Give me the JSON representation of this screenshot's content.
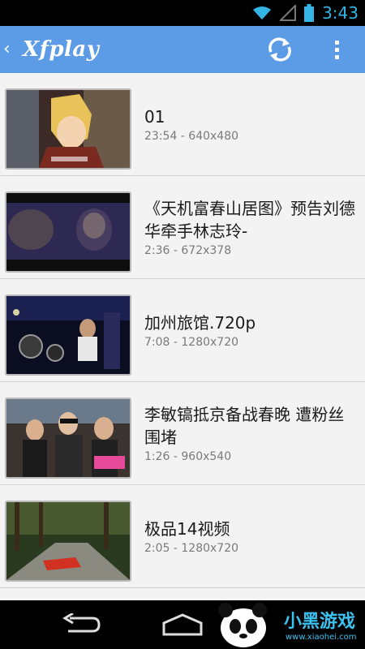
{
  "status_bar": {
    "time": "3:43",
    "icons": [
      "wifi-icon",
      "signal-icon",
      "battery-icon"
    ]
  },
  "action_bar": {
    "back_glyph": "‹",
    "title": "Xfplay",
    "refresh_icon": "refresh-icon",
    "overflow_icon": "overflow-menu-icon"
  },
  "videos": [
    {
      "title": "01",
      "meta": "23:54 - 640x480",
      "thumb_icon": "anime-thumbnail"
    },
    {
      "title": "《天机富春山居图》预告刘德华牵手林志玲-",
      "meta": "2:36 - 672x378",
      "thumb_icon": "movie-trailer-thumbnail"
    },
    {
      "title": "加州旅馆.720p",
      "meta": "7:08 - 1280x720",
      "thumb_icon": "concert-thumbnail"
    },
    {
      "title": "李敏镐抵京备战春晚 遭粉丝围堵",
      "meta": "1:26 - 960x540",
      "thumb_icon": "crowd-thumbnail"
    },
    {
      "title": "极品14视频",
      "meta": "2:05 - 1280x720",
      "thumb_icon": "racing-thumbnail"
    }
  ],
  "nav_bar": {
    "back_icon": "nav-back-icon",
    "home_icon": "nav-home-icon"
  },
  "watermark": {
    "text": "小黑游戏",
    "sub": "www.xiaohei.com"
  },
  "colors": {
    "action_bar": "#5c9be6",
    "status_time": "#33b5e5",
    "list_bg": "#f3f3f3"
  }
}
